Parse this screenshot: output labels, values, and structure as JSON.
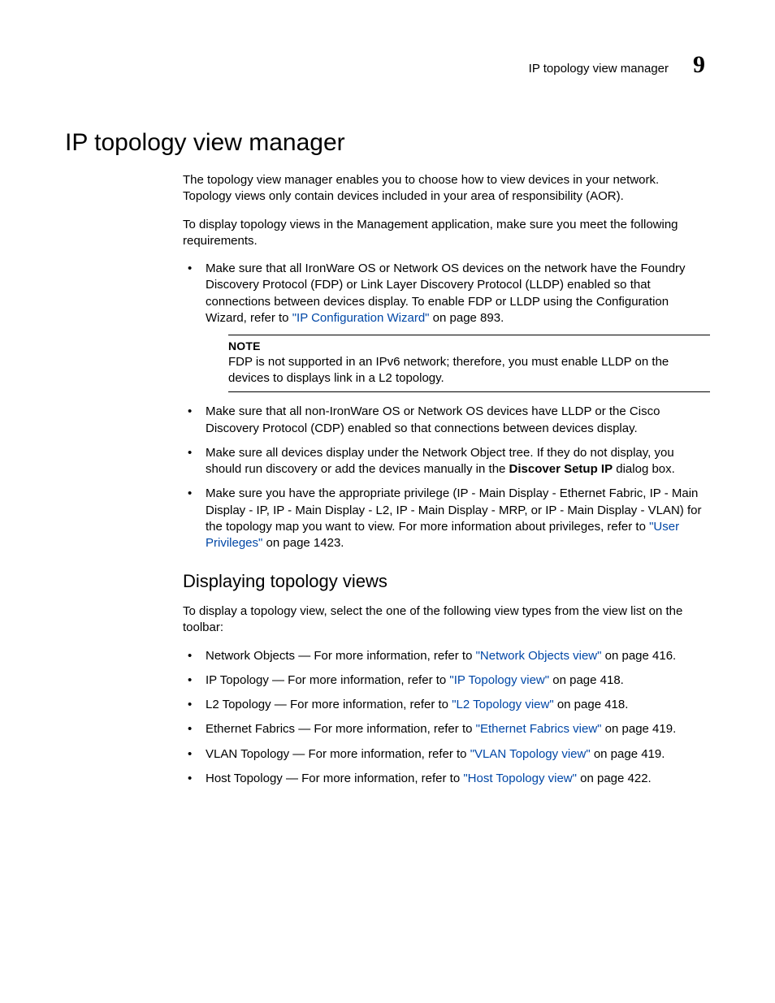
{
  "header": {
    "running": "IP topology view manager",
    "chapter": "9"
  },
  "h1": "IP topology view manager",
  "intro1": "The topology view manager enables you to choose how to view devices in your network. Topology views only contain devices included in your area of responsibility (AOR).",
  "intro2": "To display topology views in the Management application, make sure you meet the following requirements.",
  "b1": {
    "pre": "Make sure that all IronWare OS or Network OS devices on the network have the Foundry Discovery Protocol (FDP) or Link Layer Discovery Protocol (LLDP) enabled so that connections between devices display. To enable FDP or LLDP using the Configuration Wizard, refer to ",
    "link": "\"IP Configuration Wizard\"",
    "post": " on page 893."
  },
  "note": {
    "label": "NOTE",
    "text": "FDP is not supported in an IPv6 network; therefore, you must enable LLDP on the devices to displays link in a L2 topology."
  },
  "b2": "Make sure that all non-IronWare OS or Network OS devices have LLDP or the Cisco Discovery Protocol (CDP) enabled so that connections between devices display.",
  "b3": {
    "pre": "Make sure all devices display under the Network Object tree. If they do not display, you should run discovery or add the devices manually in the ",
    "bold": "Discover Setup IP",
    "post": " dialog box."
  },
  "b4": {
    "pre": "Make sure you have the appropriate privilege (IP - Main Display - Ethernet Fabric, IP - Main Display - IP, IP - Main Display - L2, IP - Main Display - MRP, or IP - Main Display - VLAN) for the topology map you want to view. For more information about privileges, refer to ",
    "link": "\"User Privileges\"",
    "post": " on page 1423."
  },
  "h2": "Displaying topology views",
  "disp_intro": "To display a topology view, select the one of the following view types from the view list on the toolbar:",
  "views": [
    {
      "pre": "Network Objects — For more information, refer to ",
      "link": "\"Network Objects view\"",
      "post": " on page 416."
    },
    {
      "pre": "IP Topology — For more information, refer to ",
      "link": "\"IP Topology view\"",
      "post": " on page 418."
    },
    {
      "pre": "L2 Topology — For more information, refer to ",
      "link": "\"L2 Topology view\"",
      "post": " on page 418."
    },
    {
      "pre": "Ethernet Fabrics — For more information, refer to ",
      "link": "\"Ethernet Fabrics view\"",
      "post": " on page 419."
    },
    {
      "pre": "VLAN Topology — For more information, refer to ",
      "link": "\"VLAN Topology view\"",
      "post": " on page 419."
    },
    {
      "pre": "Host Topology — For more information, refer to ",
      "link": "\"Host Topology view\"",
      "post": " on page 422."
    }
  ]
}
